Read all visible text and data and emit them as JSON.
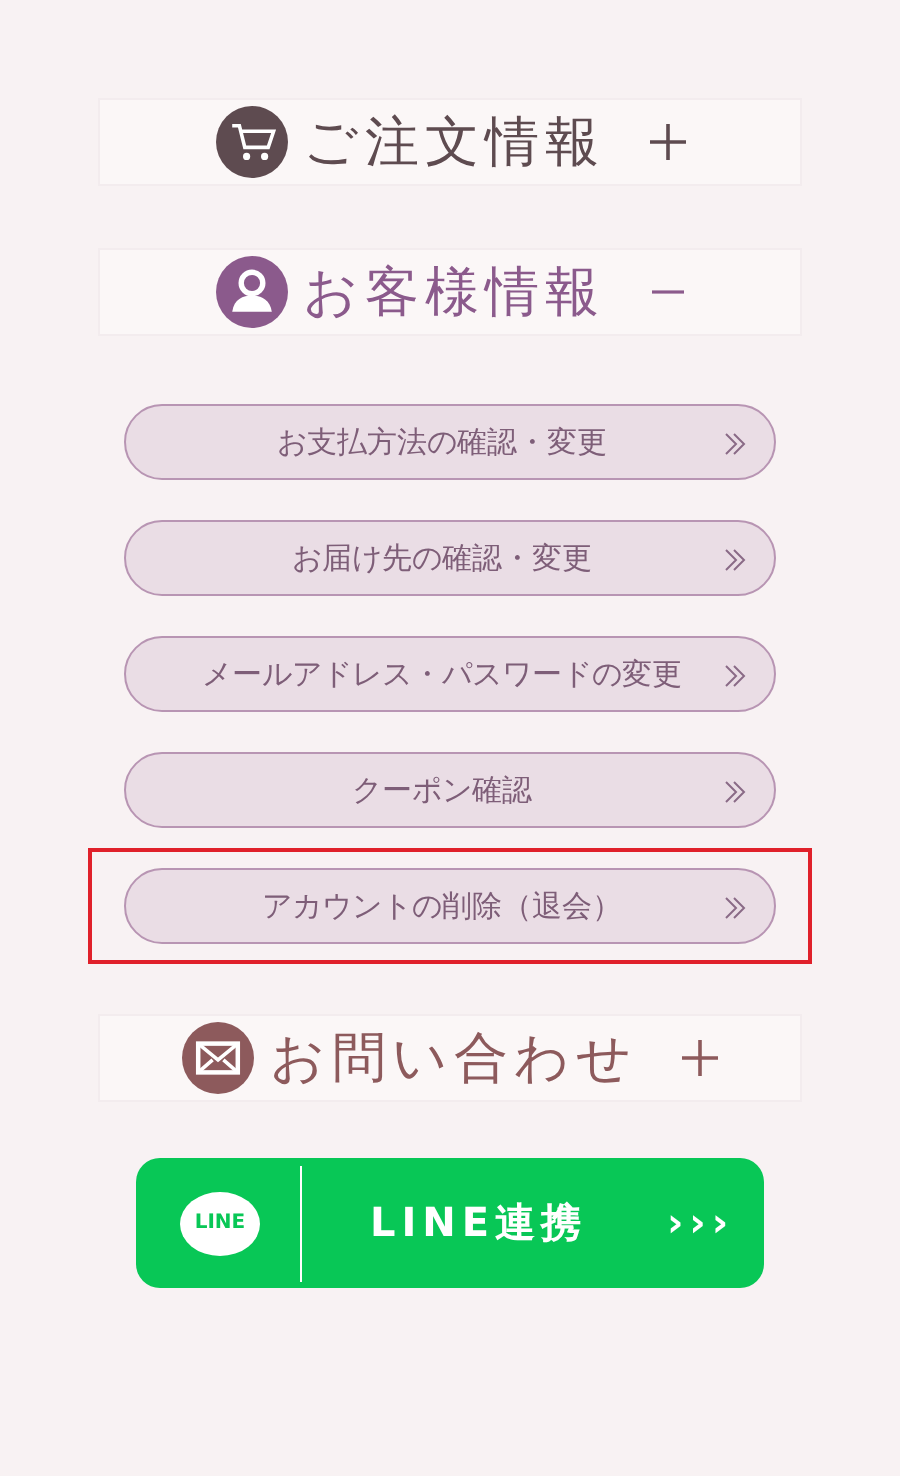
{
  "sections": [
    {
      "kind": "cart",
      "title": "ご注文情報",
      "color": "#5e4b50",
      "expanded": false
    },
    {
      "kind": "person",
      "title": "お客様情報",
      "color": "#8b5a8c",
      "expanded": true,
      "items": [
        {
          "label": "お支払方法の確認・変更",
          "highlighted": false
        },
        {
          "label": "お届け先の確認・変更",
          "highlighted": false
        },
        {
          "label": "メールアドレス・パスワードの変更",
          "highlighted": false
        },
        {
          "label": "クーポン確認",
          "highlighted": false
        },
        {
          "label": "アカウントの削除（退会）",
          "highlighted": true
        }
      ]
    },
    {
      "kind": "mail",
      "title": "お問い合わせ",
      "color": "#8d5a5c",
      "expanded": false
    }
  ],
  "line_button": {
    "logo_text": "LINE",
    "label": "LINE連携",
    "arrows": "›››"
  }
}
